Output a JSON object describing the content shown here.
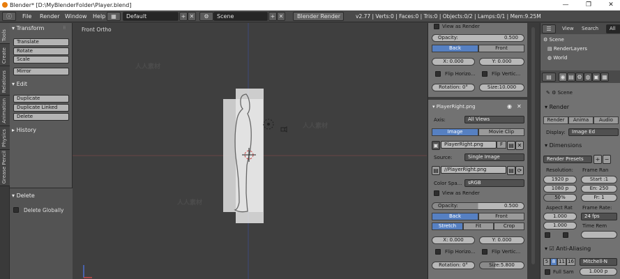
{
  "window": {
    "title": "Blender* [D:\\MyBlenderFolder\\Player.blend]",
    "minimize": "—",
    "maximize": "❐",
    "close": "✕"
  },
  "menubar": {
    "file": "File",
    "render": "Render",
    "window": "Window",
    "help": "Help",
    "layout": "Default",
    "scene": "Scene",
    "engine": "Blender Render",
    "stats": "v2.77 | Verts:0 | Faces:0 | Tris:0 | Objects:0/2 | Lamps:0/1 | Mem:9.25M"
  },
  "tabs": [
    "Tools",
    "Create",
    "Relations",
    "Animation",
    "Physics",
    "Grease Pencil"
  ],
  "toolshelf": {
    "transform_header": "Transform",
    "translate": "Translate",
    "rotate": "Rotate",
    "scale": "Scale",
    "mirror": "Mirror",
    "edit_header": "Edit",
    "duplicate": "Duplicate",
    "duplicate_linked": "Duplicate Linked",
    "delete": "Delete",
    "history_header": "History",
    "delete_header": "Delete",
    "delete_globally": "Delete Globally"
  },
  "viewport": {
    "view_label": "Front Ortho"
  },
  "background_images": {
    "view_as_render_top": "View as Render",
    "opacity_label": "Opacity:",
    "opacity_top": "0.500",
    "back": "Back",
    "front": "Front",
    "x_label": "X:",
    "y_label": "Y:",
    "x_top": "0.000",
    "y_top": "0.000",
    "flip_h": "Flip Horizo...",
    "flip_v": "Flip Vertic...",
    "rotation_label": "Rotation:",
    "rotation_top": "0°",
    "size_label": "Size:",
    "size_top": "10.000",
    "image_name": "PlayerRight.png",
    "axis_label": "Axis:",
    "axis_value": "All Views",
    "image_tab": "Image",
    "movie_clip_tab": "Movie Clip",
    "image_block": "PlayerRight.png",
    "f_button": "F",
    "source_label": "Source:",
    "source_value": "Single Image",
    "filepath": "//PlayerRight.png",
    "color_space_label": "Color Spa...",
    "color_space_value": "sRGB",
    "view_as_render": "View as Render",
    "opacity": "0.500",
    "stretch": "Stretch",
    "fit": "Fit",
    "crop": "Crop",
    "x": "0.000",
    "y": "0.000",
    "rotation": "0°",
    "size": "5.800"
  },
  "outliner": {
    "view": "View",
    "search": "Search",
    "all": "All",
    "scene": "Scene",
    "render_layers": "RenderLayers",
    "world": "World"
  },
  "render_props": {
    "scene_label": "Scene",
    "render_header": "Render",
    "render_btn": "Render",
    "anim_btn": "Anima",
    "audio_btn": "Audio",
    "display_label": "Display:",
    "display_value": "Image Ed",
    "dimensions_header": "Dimensions",
    "render_presets": "Render Presets",
    "resolution_label": "Resolution:",
    "res_x": "1920 p",
    "res_y": "1080 p",
    "res_pct": "50%",
    "frame_range_label": "Frame Ran",
    "start": "Start :1",
    "end": "En: 250",
    "frame": "Fr: 1",
    "aspect_label": "Aspect Rat",
    "aspect_x": "1.000",
    "aspect_y": "1.000",
    "frame_rate_label": "Frame Rate:",
    "fps": "24 fps",
    "time_remap_label": "Time Rem",
    "aa_header": "Anti-Aliasing",
    "aa_5": "5",
    "aa_8": "8",
    "aa_11": "11",
    "aa_16": "16",
    "aa_filter": "Mitchell-N",
    "full_sample": "Full Sam",
    "aa_size": "1.000 p"
  }
}
